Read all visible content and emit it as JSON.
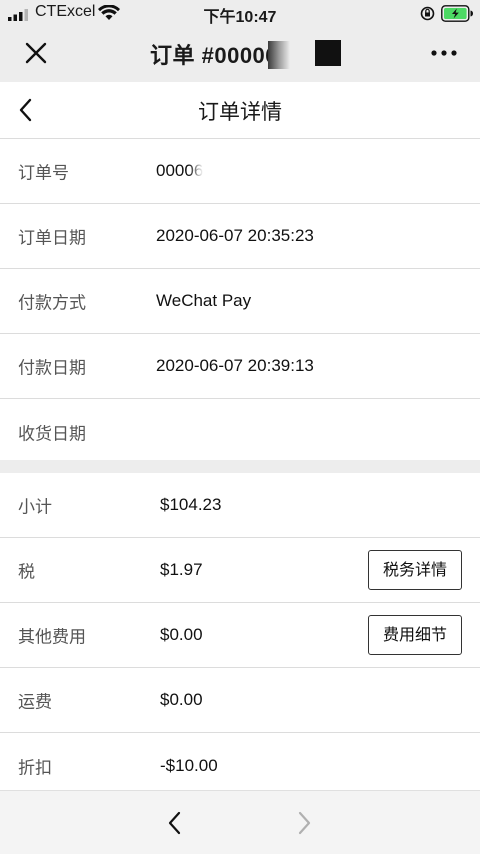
{
  "status_bar": {
    "carrier": "CTExcel",
    "time": "下午10:47"
  },
  "app_bar": {
    "title": "订单 #00006"
  },
  "page": {
    "title": "订单详情"
  },
  "order_info": [
    {
      "label": "订单号",
      "value": "00006"
    },
    {
      "label": "订单日期",
      "value": "2020-06-07 20:35:23"
    },
    {
      "label": "付款方式",
      "value": "WeChat Pay"
    },
    {
      "label": "付款日期",
      "value": "2020-06-07 20:39:13"
    },
    {
      "label": "收货日期",
      "value": ""
    }
  ],
  "totals": [
    {
      "label": "小计",
      "value": "$104.23"
    },
    {
      "label": "税",
      "value": "$1.97",
      "button": "税务详情"
    },
    {
      "label": "其他费用",
      "value": "$0.00",
      "button": "费用细节"
    },
    {
      "label": "运费",
      "value": "$0.00"
    },
    {
      "label": "折扣",
      "value": "-$10.00"
    }
  ],
  "colors": {
    "top_bar_bg": "#ededed",
    "divider": "#dcdcdc",
    "battery_fill": "#4cd964"
  },
  "icons": {
    "close": "close-icon",
    "more": "more-icon",
    "back": "chevron-left-icon",
    "nav_back": "chevron-left-icon",
    "nav_forward": "chevron-right-icon"
  }
}
